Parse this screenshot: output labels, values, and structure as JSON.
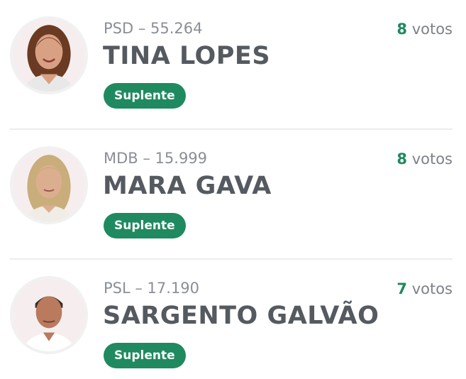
{
  "candidates": [
    {
      "party": "PSD – 55.264",
      "name": "TINA LOPES",
      "votes_count": "8",
      "votes_label": "votos",
      "status": "Suplente",
      "avatar": "candidate-photo-woman-dark-hair"
    },
    {
      "party": "MDB – 15.999",
      "name": "MARA GAVA",
      "votes_count": "8",
      "votes_label": "votos",
      "status": "Suplente",
      "avatar": "candidate-photo-woman-blonde-hair"
    },
    {
      "party": "PSL – 17.190",
      "name": "SARGENTO GALVÃO",
      "votes_count": "7",
      "votes_label": "votos",
      "status": "Suplente",
      "avatar": "candidate-photo-man-short-hair"
    }
  ],
  "colors": {
    "badge_bg": "#1f8a5f",
    "votes_accent": "#1e8a5e",
    "name_text": "#555a60",
    "party_text": "#8a8f96"
  }
}
